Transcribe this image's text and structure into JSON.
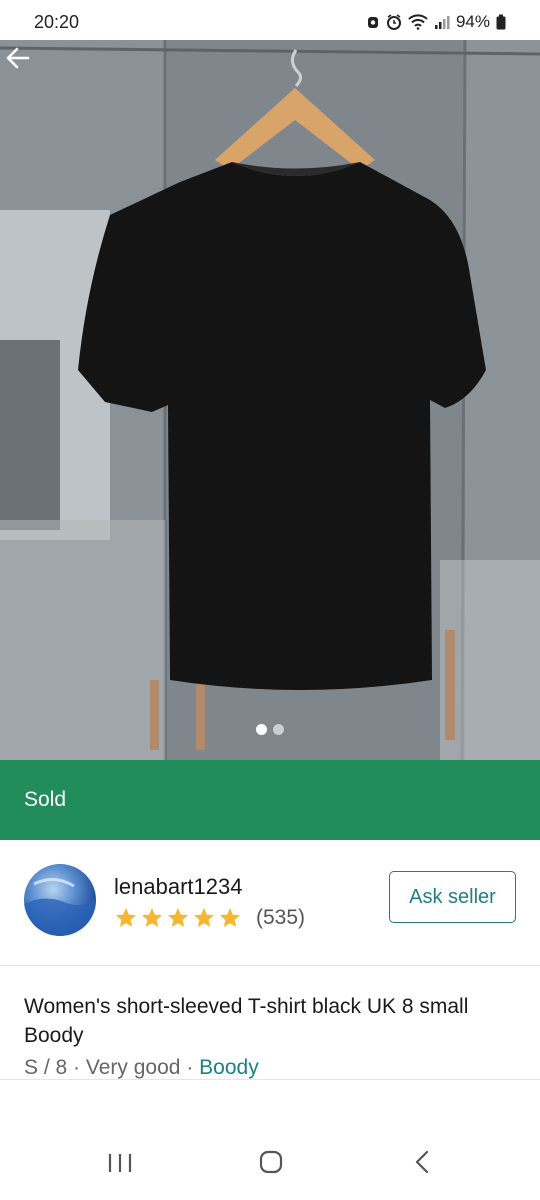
{
  "status_bar": {
    "time": "20:20",
    "battery": "94%",
    "icons": [
      "alarm-icon",
      "clock-icon",
      "wifi-icon",
      "signal-icon",
      "battery-icon"
    ]
  },
  "product": {
    "photo_description_icon": "tshirt-photo",
    "image_count": 2,
    "active_image": 1,
    "status_label": "Sold",
    "title": "Women's short-sleeved T-shirt black UK 8 small Boody",
    "size": "S / 8",
    "separator": "·",
    "condition": "Very good",
    "brand": "Boody"
  },
  "seller": {
    "username": "lenabart1234",
    "rating_stars": 5,
    "review_count": "(535)",
    "ask_label": "Ask seller"
  },
  "colors": {
    "sold_banner": "#218d5a",
    "accent": "#1e7f86",
    "star": "#f5b731"
  },
  "navigation": {
    "icons": [
      "recent-apps-icon",
      "home-icon",
      "back-nav-icon"
    ]
  }
}
